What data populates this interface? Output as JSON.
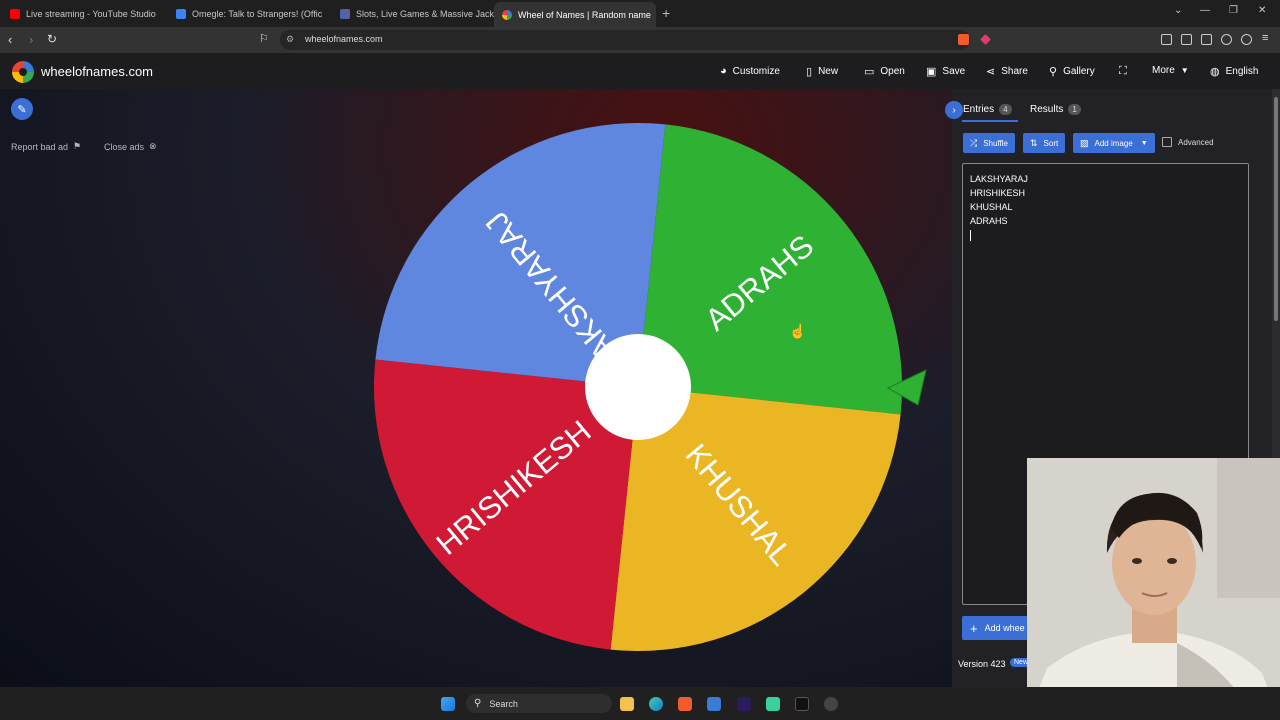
{
  "browser": {
    "tabs": [
      {
        "title": "Live streaming - YouTube Studio",
        "favicon_color": "#ff0000"
      },
      {
        "title": "Omegle: Talk to Strangers! (Offic",
        "favicon_color": "#3b82f6"
      },
      {
        "title": "Slots, Live Games & Massive Jackpot",
        "favicon_color": "#5561a8"
      },
      {
        "title": "Wheel of Names | Random name",
        "favicon_color": "#34a853"
      }
    ],
    "url": "wheelofnames.com"
  },
  "site": {
    "name": "wheelofnames.com",
    "menu": [
      "Customize",
      "New",
      "Open",
      "Save",
      "Share",
      "Gallery",
      "More",
      "English"
    ]
  },
  "ads": {
    "report_label": "Report bad ad",
    "close_label": "Close ads"
  },
  "wheel": {
    "segments": [
      {
        "name": "LAKSHYARAJ",
        "color": "#5f87e0"
      },
      {
        "name": "ADRAHS",
        "color": "#2fb134"
      },
      {
        "name": "KHUSHAL",
        "color": "#eab623"
      },
      {
        "name": "HRISHIKESH",
        "color": "#d01a35"
      }
    ]
  },
  "panel": {
    "tabs": {
      "entries_label": "Entries",
      "entries_count": "4",
      "results_label": "Results",
      "results_count": "1"
    },
    "buttons": {
      "shuffle": "Shuffle",
      "sort": "Sort",
      "add_image": "Add image",
      "advanced": "Advanced"
    },
    "entries": [
      "LAKSHYARAJ",
      "HRISHIKESH",
      "KHUSHAL",
      "ADRAHS"
    ],
    "add_wheel_label": "Add whee",
    "version": "Version 423",
    "new_badge": "New"
  },
  "taskbar": {
    "search_label": "Search"
  }
}
